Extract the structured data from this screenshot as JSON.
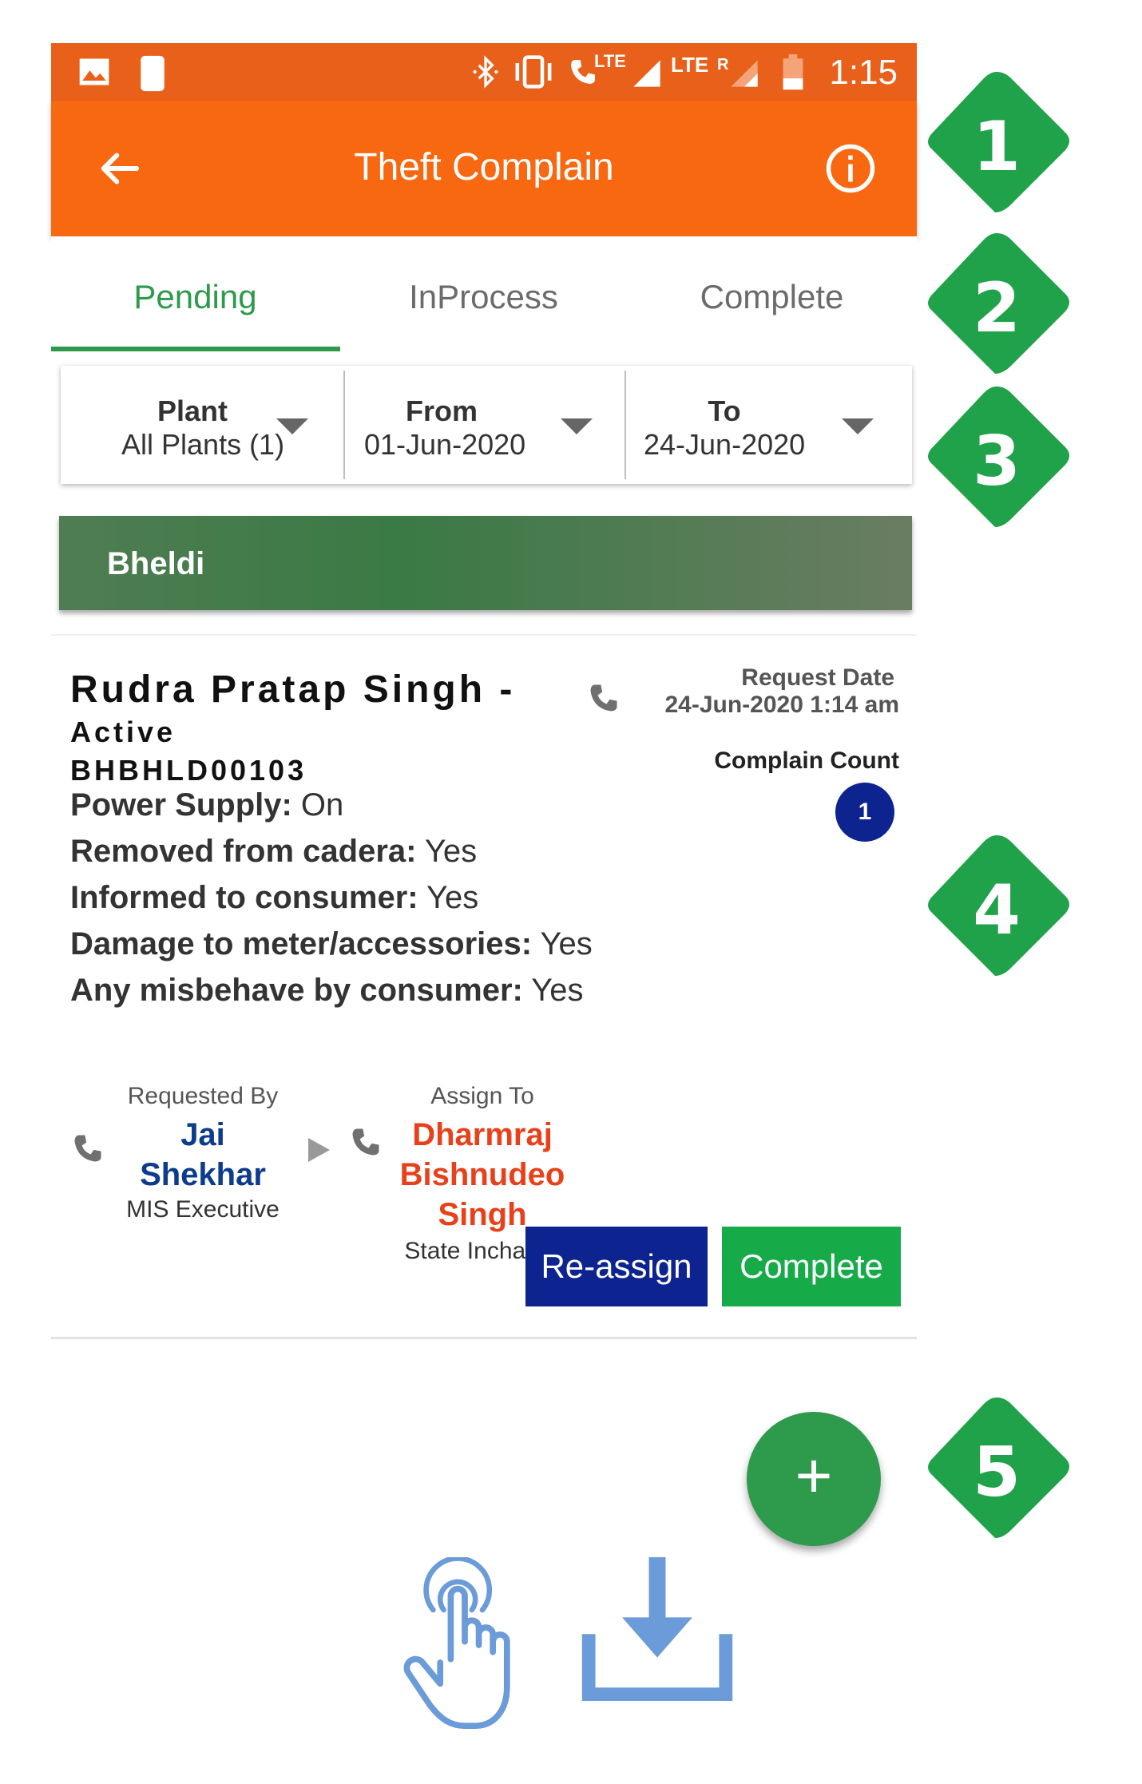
{
  "status_bar": {
    "time": "1:15",
    "lte1": "LTE",
    "lte2": "LTE",
    "roaming": "R"
  },
  "app_bar": {
    "title": "Theft Complain"
  },
  "tabs": [
    {
      "label": "Pending",
      "active": true
    },
    {
      "label": "InProcess",
      "active": false
    },
    {
      "label": "Complete",
      "active": false
    }
  ],
  "filters": {
    "plant": {
      "label": "Plant",
      "value": "All Plants (1)"
    },
    "from": {
      "label": "From",
      "value": "01-Jun-2020"
    },
    "to": {
      "label": "To",
      "value": "24-Jun-2020"
    }
  },
  "plant_header": {
    "name": "Bheldi"
  },
  "complaint": {
    "name": "Rudra Pratap Singh -",
    "status": "Active",
    "id": "BHBHLD00103",
    "request_date_label": "Request Date",
    "request_date": "24-Jun-2020 1:14 am",
    "complain_count_label": "Complain Count",
    "complain_count": "1",
    "fields": [
      {
        "key": "Power Supply:",
        "value": " On"
      },
      {
        "key": "Removed from cadera:",
        "value": " Yes"
      },
      {
        "key": "Informed to consumer:",
        "value": " Yes"
      },
      {
        "key": "Damage to meter/accessories:",
        "value": " Yes"
      },
      {
        "key": "Any misbehave by consumer:",
        "value": " Yes"
      }
    ],
    "requested_by": {
      "label": "Requested By",
      "name_line1": "Jai",
      "name_line2": "Shekhar",
      "role": "MIS Executive"
    },
    "assign_to": {
      "label": "Assign To",
      "name_line1": "Dharmraj",
      "name_line2": "Bishnudeo",
      "name_line3": "Singh",
      "role": "State Incharge"
    },
    "buttons": {
      "reassign": "Re-assign",
      "complete": "Complete"
    }
  },
  "fab": {
    "label": "+"
  },
  "callouts": [
    "1",
    "2",
    "3",
    "4",
    "5"
  ],
  "colors": {
    "status_bar": "#e8601a",
    "app_bar": "#f76810",
    "accent_green": "#2e9a4c",
    "navy": "#0d238f",
    "requested_by_name": "#0d3c8f",
    "assign_to_name": "#e8401a",
    "callout_green": "#1fa24a",
    "bottom_icon_blue": "#6b9bd8"
  },
  "icons": {
    "status_bar": [
      "image-icon",
      "moon-icon",
      "bluetooth-icon",
      "vibrate-icon",
      "phone-lte-icon",
      "signal-icon",
      "signal-roaming-icon",
      "battery-icon"
    ],
    "app_bar": [
      "back-arrow-icon",
      "info-icon"
    ],
    "bottom": [
      "touch-hand-icon",
      "download-icon"
    ]
  }
}
